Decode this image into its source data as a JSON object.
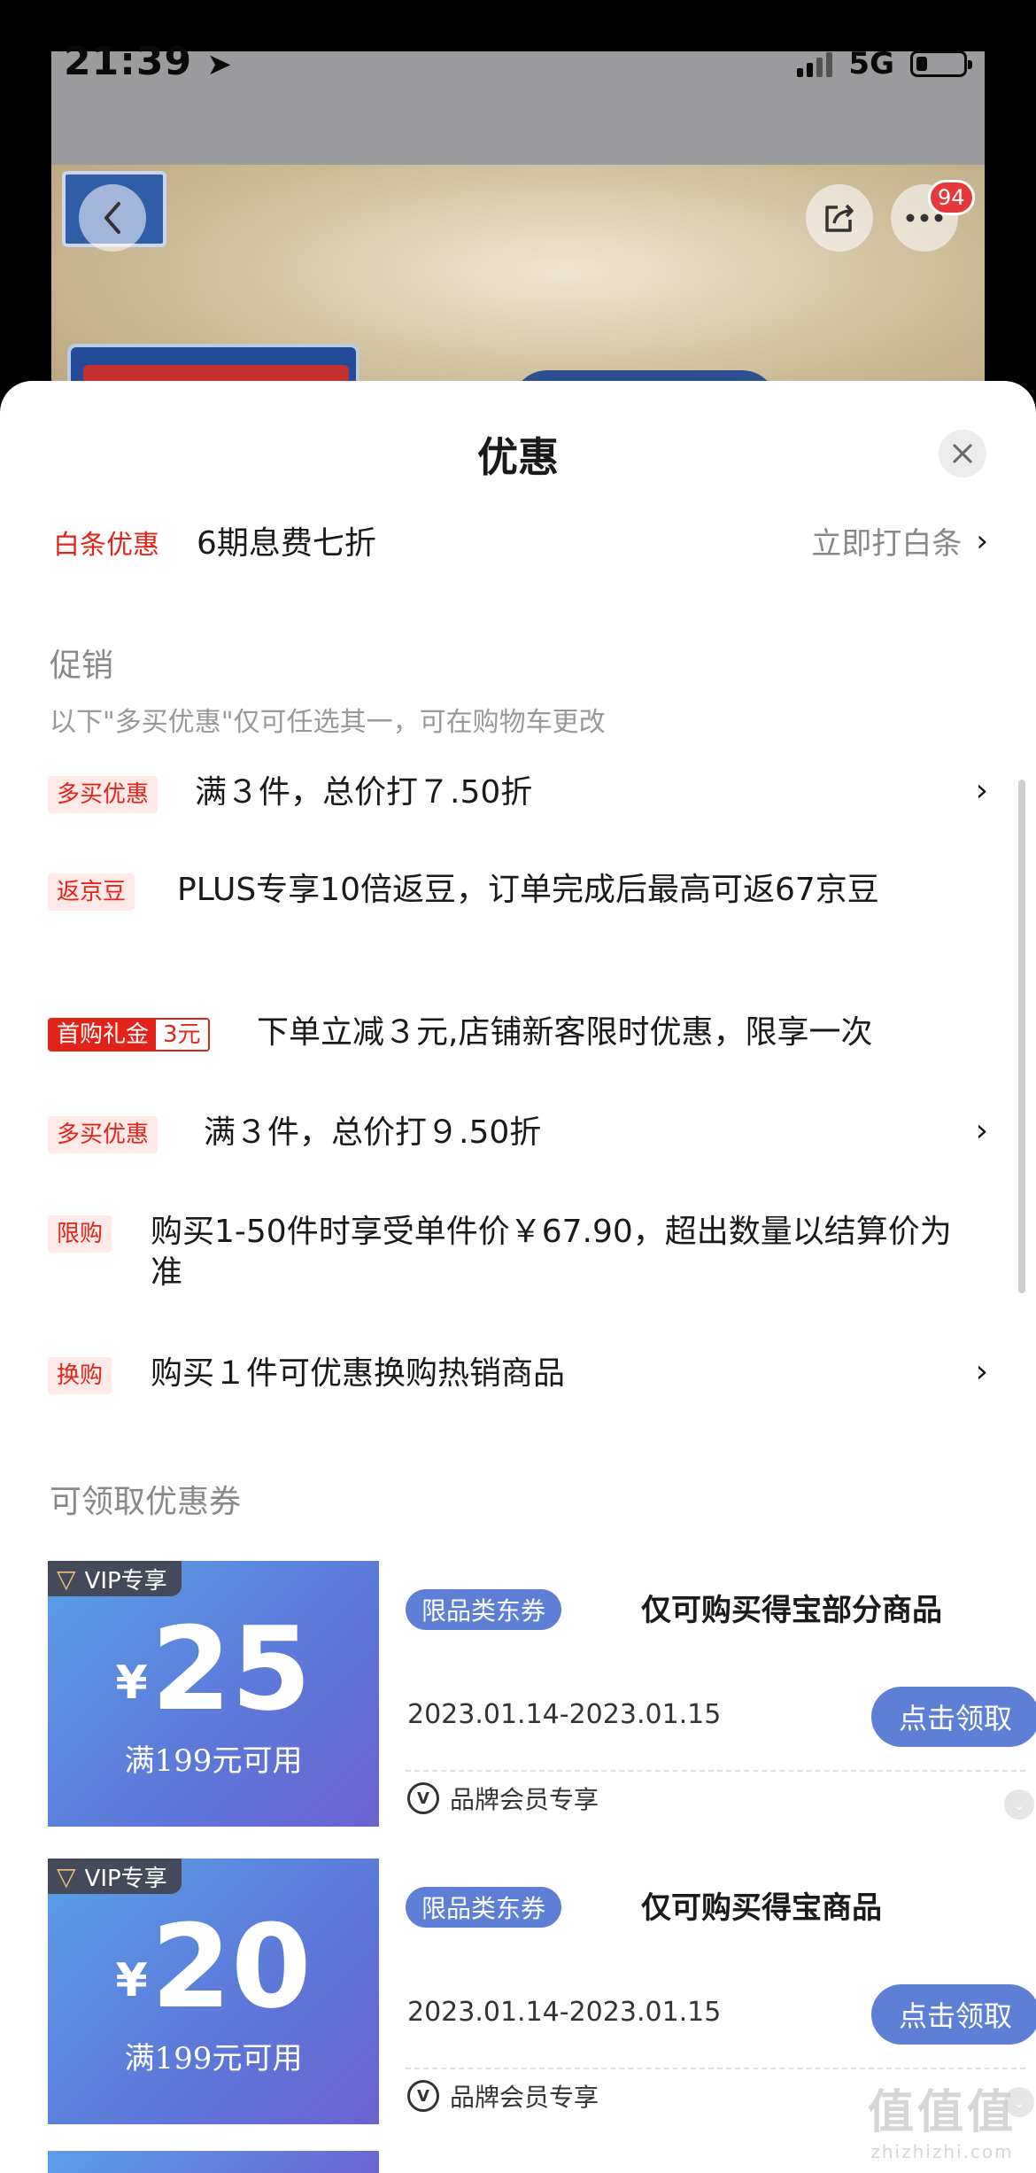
{
  "status_bar": {
    "time": "21:39",
    "network": "5G"
  },
  "product_nav": {
    "badge_count": "94"
  },
  "sheet": {
    "title": "优惠",
    "baitiao": {
      "label": "白条优惠",
      "text": "6期息费七折",
      "link": "立即打白条"
    },
    "promo": {
      "title": "促销",
      "note": "以下\"多买优惠\"仅可任选其一，可在购物车更改",
      "items": [
        {
          "tag": "多买优惠",
          "text": "满３件，总价打７.50折"
        },
        {
          "tag": "返京豆",
          "text": "PLUS专享10倍返豆，订单完成后最高可返67京豆"
        },
        {
          "tag": "首购礼金",
          "tag_amount": "3元",
          "text": "下单立减３元,店铺新客限时优惠，限享一次"
        },
        {
          "tag": "多买优惠",
          "text": "满３件，总价打９.50折"
        },
        {
          "tag": "限购",
          "text": "购买1-50件时享受单件价￥67.90，超出数量以结算价为准"
        },
        {
          "tag": "换购",
          "text": "购买１件可优惠换购热销商品"
        }
      ]
    },
    "coupons": {
      "title": "可领取优惠券",
      "items": [
        {
          "vip": "VIP专享",
          "currency": "¥",
          "amount": "25",
          "condition": "满199元可用",
          "category": "限品类东券",
          "title": "仅可购买得宝部分商品",
          "date": "2023.01.14-2023.01.15",
          "button": "点击领取",
          "member": "品牌会员专享"
        },
        {
          "vip": "VIP专享",
          "currency": "¥",
          "amount": "20",
          "condition": "满199元可用",
          "category": "限品类东券",
          "title": "仅可购买得宝商品",
          "date": "2023.01.14-2023.01.15",
          "button": "点击领取",
          "member": "品牌会员专享"
        }
      ]
    }
  },
  "watermark": {
    "glyphs": "值值值",
    "site": "zhizhizhi.com"
  },
  "colors": {
    "accent_red": "#e2231a",
    "coupon_blue": "#5d80d6",
    "badge_red": "#e5393b"
  }
}
